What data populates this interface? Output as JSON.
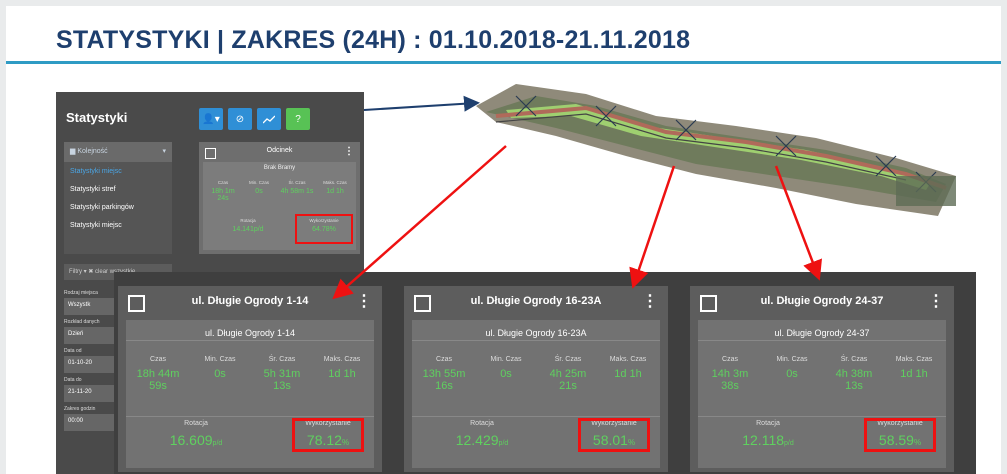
{
  "slide": {
    "title": "STATYSTYKI | ZAKRES (24H) : 01.10.2018-21.11.2018"
  },
  "app": {
    "title": "Statystyki",
    "toolbar": [
      "",
      "⊘",
      "",
      "?"
    ],
    "sidebar": {
      "header": "Kolejność",
      "items": [
        {
          "label": "Statystyki miejsc",
          "active": true
        },
        {
          "label": "Statystyki stref"
        },
        {
          "label": "Statystyki parkingów"
        },
        {
          "label": "Statystyki miejsc"
        }
      ]
    },
    "filters_label": "Filtry ▾  ✖ clear wszystkie",
    "filter_fields": [
      {
        "label": "Rodzaj miejsca",
        "value": "Wszystk"
      },
      {
        "label": "Rozkład danych",
        "value": "Dzień"
      },
      {
        "label": "Data od",
        "value": "01-10-20"
      },
      {
        "label": "Data do",
        "value": "21-11-20"
      },
      {
        "label": "Zakres godzin",
        "value": "00:00"
      }
    ],
    "small_card": {
      "name": "Odcinek",
      "sub": "Brak Bramy",
      "metrics": [
        {
          "label": "Czas",
          "value": "18h 1m 24s"
        },
        {
          "label": "Min. Czas",
          "value": "0s"
        },
        {
          "label": "Śr. Czas",
          "value": "4h 58m 1s"
        },
        {
          "label": "Maks. Czas",
          "value": "1d 1h"
        }
      ],
      "rotacja_label": "Rotacja",
      "rotacja_value": "14.141p/d",
      "wyk_label": "Wykorzystanie",
      "wyk_value": "64.78%"
    }
  },
  "cards": [
    {
      "name": "ul. Długie Ogrody 1-14",
      "sub": "ul. Długie Ogrody 1-14",
      "metrics": [
        {
          "label": "Czas",
          "line1": "18h 44m",
          "line2": "59s"
        },
        {
          "label": "Min. Czas",
          "line1": "0s",
          "line2": ""
        },
        {
          "label": "Śr. Czas",
          "line1": "5h 31m",
          "line2": "13s"
        },
        {
          "label": "Maks. Czas",
          "line1": "1d 1h",
          "line2": ""
        }
      ],
      "rotacja_label": "Rotacja",
      "rotacja_value": "16.609",
      "rotacja_unit": "p/d",
      "wyk_label": "Wykorzystanie",
      "wyk_value": "78.12",
      "wyk_unit": "%"
    },
    {
      "name": "ul. Długie Ogrody 16-23A",
      "sub": "ul. Długie Ogrody 16-23A",
      "metrics": [
        {
          "label": "Czas",
          "line1": "13h 55m",
          "line2": "16s"
        },
        {
          "label": "Min. Czas",
          "line1": "0s",
          "line2": ""
        },
        {
          "label": "Śr. Czas",
          "line1": "4h 25m",
          "line2": "21s"
        },
        {
          "label": "Maks. Czas",
          "line1": "1d 1h",
          "line2": ""
        }
      ],
      "rotacja_label": "Rotacja",
      "rotacja_value": "12.429",
      "rotacja_unit": "p/d",
      "wyk_label": "Wykorzystanie",
      "wyk_value": "58.01",
      "wyk_unit": "%"
    },
    {
      "name": "ul. Długie Ogrody 24-37",
      "sub": "ul. Długie Ogrody 24-37",
      "metrics": [
        {
          "label": "Czas",
          "line1": "14h 3m",
          "line2": "38s"
        },
        {
          "label": "Min. Czas",
          "line1": "0s",
          "line2": ""
        },
        {
          "label": "Śr. Czas",
          "line1": "4h 38m",
          "line2": "13s"
        },
        {
          "label": "Maks. Czas",
          "line1": "1d 1h",
          "line2": ""
        }
      ],
      "rotacja_label": "Rotacja",
      "rotacja_value": "12.118",
      "rotacja_unit": "p/d",
      "wyk_label": "Wykorzystanie",
      "wyk_value": "58.59",
      "wyk_unit": "%"
    }
  ],
  "colors": {
    "title": "#1e3f6e",
    "rule": "#2f9bc4",
    "value_green": "#5fd05f",
    "highlight_red": "#ee1111",
    "arrow_blue": "#1e3f6e"
  }
}
